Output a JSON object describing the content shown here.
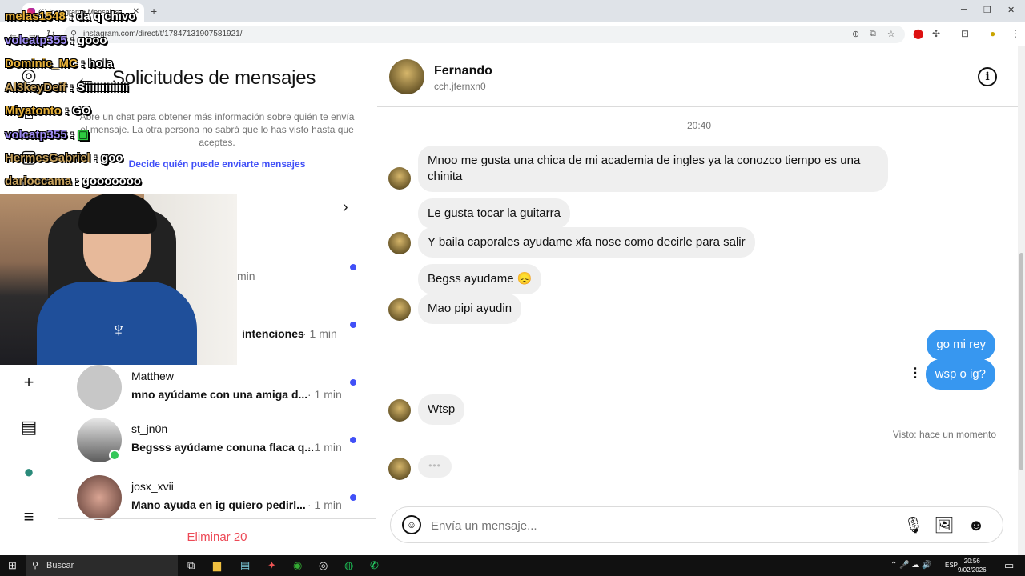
{
  "browser": {
    "tab_title": "(6) Instagram • Mensajes",
    "url": "instagram.com/direct/t/17847131907581921/"
  },
  "requests": {
    "title": "Solicitudes de mensajes",
    "description": "Abre un chat para obtener más información sobre quién te envía el mensaje. La otra persona no sabrá que lo has visto hasta que aceptes.",
    "link": "Decide quién puede enviarte mensajes",
    "partial_time": "min",
    "partial_intenciones": "intenciones",
    "partial_intenciones_time": "· 1 min",
    "threads": [
      {
        "username": "Matthew",
        "preview": "mno ayúdame con una amiga d...",
        "time": "· 1 min"
      },
      {
        "username": "st_jn0n",
        "preview": "Begsss ayúdame conuna flaca q...",
        "time": "· 1 min"
      },
      {
        "username": "josx_xvii",
        "preview": "Mano ayuda en ig quiero pedirl...",
        "time": "· 1 min"
      }
    ],
    "delete_label": "Eliminar 20"
  },
  "chat": {
    "name": "Fernando",
    "username": "cch.jfernxn0",
    "timestamp": "20:40",
    "messages": [
      {
        "from": "them",
        "text": "Mnoo me gusta una chica de mi academia de ingles ya la conozco tiempo es una chinita"
      },
      {
        "from": "them",
        "text": "Le gusta tocar la guitarra"
      },
      {
        "from": "them",
        "text": "Y baila caporales ayudame xfa nose como decirle para salir"
      },
      {
        "from": "them",
        "text": "Begss ayudame 😞"
      },
      {
        "from": "them",
        "text": "Mao pipi ayudin"
      },
      {
        "from": "me",
        "text": "go mi rey"
      },
      {
        "from": "me",
        "text": "wsp o ig?"
      },
      {
        "from": "them",
        "text": "Wtsp"
      }
    ],
    "seen": "Visto: hace un momento",
    "typing": "•••",
    "composer_placeholder": "Envía un mensaje..."
  },
  "stream_chat": [
    {
      "user": "melas1548",
      "text": " : da q chivo"
    },
    {
      "user": "volcatp355",
      "text": " : gooo"
    },
    {
      "user": "Dominic_MC",
      "text": " : hola"
    },
    {
      "user": "Al3keyDeif",
      "text": " : Siiiiiiiiiiiii"
    },
    {
      "user": "Miyatonto",
      "text": " : GO"
    },
    {
      "user": "volcatp355",
      "text": " : "
    },
    {
      "user": "HermesGabriel",
      "text": " : goo"
    },
    {
      "user": "darioccama",
      "text": " : gooooooo"
    }
  ],
  "taskbar": {
    "search": "Buscar",
    "lang": "ESP",
    "time": "20:56",
    "date": "9/02/2026"
  },
  "colors": {
    "accent": "#4150f7",
    "my_bubble": "#3797f0",
    "their_bubble": "#efefef",
    "delete": "#ed4956"
  }
}
